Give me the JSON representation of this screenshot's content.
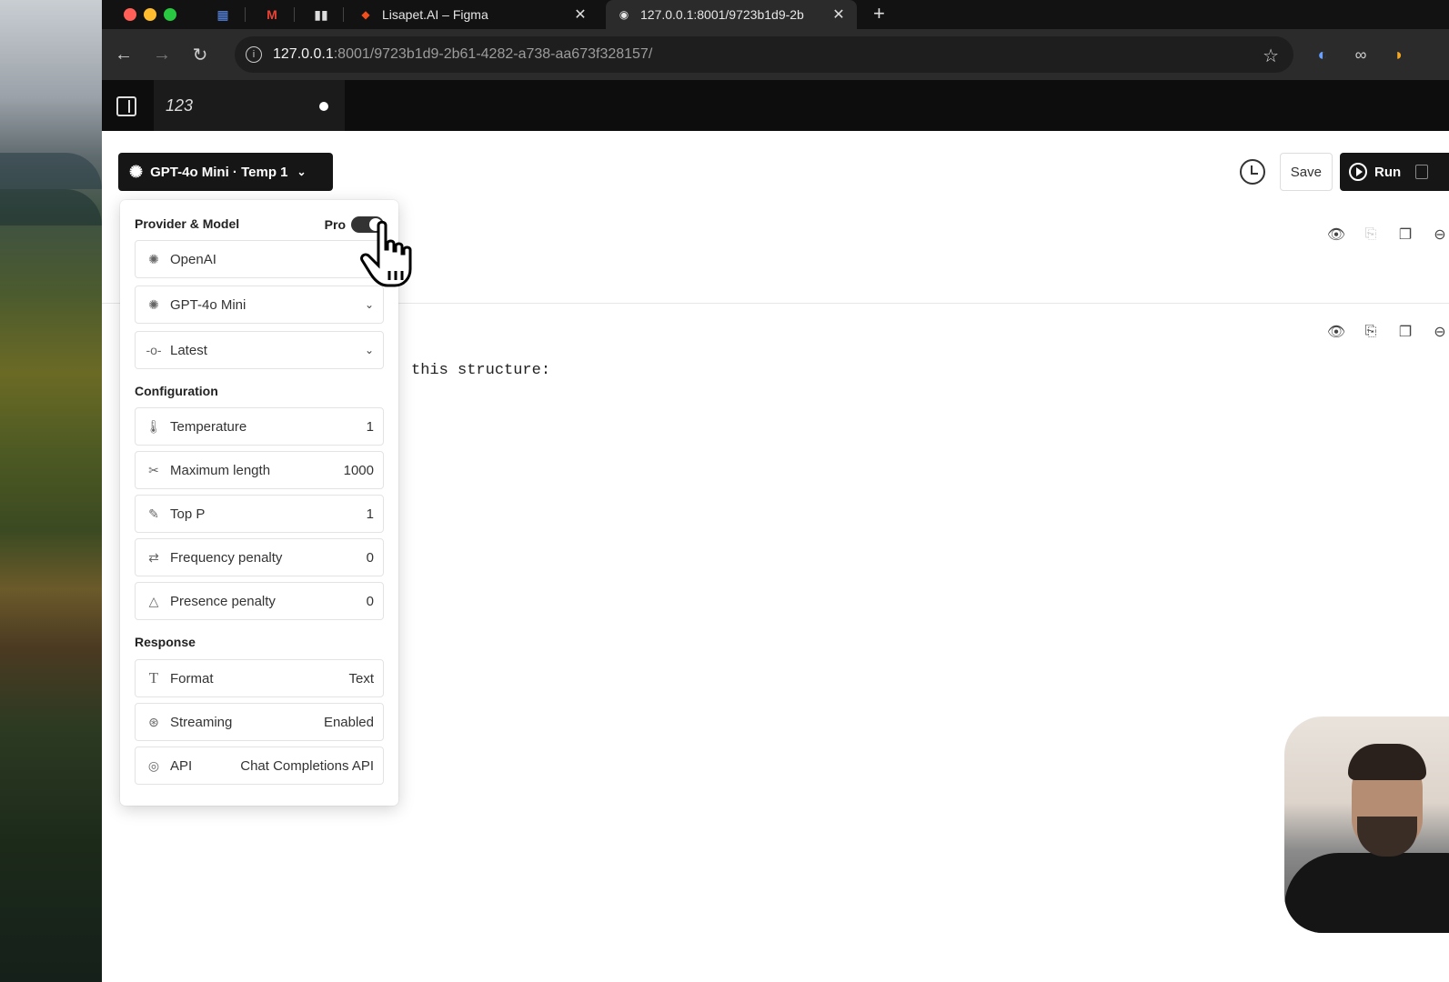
{
  "browser": {
    "tabs": [
      {
        "title": "Lisapet.AI – Figma",
        "icon": "figma-icon"
      },
      {
        "title": "127.0.0.1:8001/9723b1d9-2b",
        "icon": "app-icon"
      }
    ],
    "url_host": "127.0.0.1",
    "url_path": ":8001/9723b1d9-2b61-4282-a738-aa673f328157/"
  },
  "app": {
    "doc_tab": "123"
  },
  "toolbar": {
    "model_label": "GPT-4o Mini · Temp 1",
    "save_label": "Save",
    "run_label": "Run"
  },
  "panel": {
    "provider_section": "Provider & Model",
    "pro_label": "Pro",
    "provider": "OpenAI",
    "model": "GPT-4o Mini",
    "version": "Latest",
    "config_section": "Configuration",
    "config": [
      {
        "label": "Temperature",
        "value": "1",
        "icon": "thermometer-icon"
      },
      {
        "label": "Maximum length",
        "value": "1000",
        "icon": "scissors-icon"
      },
      {
        "label": "Top P",
        "value": "1",
        "icon": "pen-icon"
      },
      {
        "label": "Frequency penalty",
        "value": "0",
        "icon": "repeat-icon"
      },
      {
        "label": "Presence penalty",
        "value": "0",
        "icon": "triangle-icon"
      }
    ],
    "response_section": "Response",
    "response": [
      {
        "label": "Format",
        "value": "Text",
        "icon": "text-icon"
      },
      {
        "label": "Streaming",
        "value": "Enabled",
        "icon": "aperture-icon"
      },
      {
        "label": "API",
        "value": "Chat Completions API",
        "icon": "target-icon"
      }
    ]
  },
  "editor": {
    "snippet": "this structure:"
  },
  "colors": {
    "dark": "#161616",
    "accent_toggle": "#333333"
  }
}
